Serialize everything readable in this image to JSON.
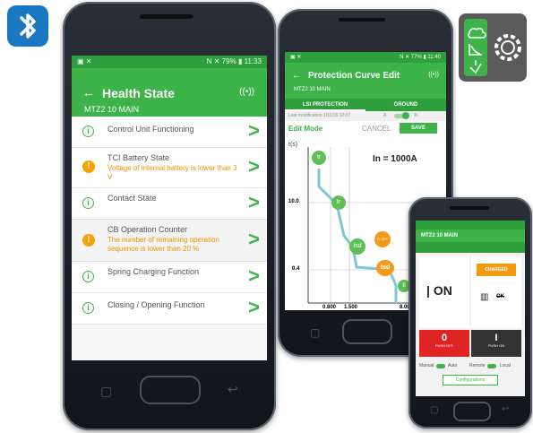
{
  "colors": {
    "green": "#3db34a",
    "orange": "#f5a300",
    "red": "#e02424",
    "blue": "#1a78c2"
  },
  "bluetooth_badge": {
    "icon": "bluetooth-icon"
  },
  "app_icon": {
    "icons": [
      "gear-icon",
      "cloud-icon",
      "curve-icon",
      "breaker-icon"
    ]
  },
  "phone1": {
    "status": {
      "left": "▣  ✕",
      "right": "N ✕ 79% ▮ 11:33"
    },
    "title": "Health State",
    "subtitle": "MTZ2 10 MAIN",
    "items": [
      {
        "label": "Control Unit Functioning",
        "icon": "info-icon",
        "warning": ""
      },
      {
        "label": "TCI Battery State",
        "icon": "warning-icon",
        "warning": "Voltage of internal battery is lower than 3 V"
      },
      {
        "label": "Contact State",
        "icon": "info-icon",
        "warning": ""
      },
      {
        "label": "CB Operation Counter",
        "icon": "warning-icon",
        "warning": "The number of remaining operation sequence is lower than 20 %"
      },
      {
        "label": "Spring Charging Function",
        "icon": "info-icon",
        "warning": ""
      },
      {
        "label": "Closing / Opening Function",
        "icon": "info-icon",
        "warning": ""
      }
    ]
  },
  "phone2": {
    "status": {
      "left": "▣  ✕",
      "right": "N ✕ 77% ▮ 11:40"
    },
    "title": "Protection Curve Edit",
    "subtitle": "MTZ2 10 MAIN",
    "tabs": [
      "LSI PROTECTION",
      "GROUND"
    ],
    "last_modification": "Last modification 1/11/16 12:07",
    "toggle_left": "A",
    "toggle_right": "%",
    "edit_mode": "Edit Mode",
    "cancel": "CANCEL",
    "save": "SAVE",
    "in_label": "In = 1000A",
    "y_axis": "t(s)",
    "y_ticks": [
      "10.0",
      "0.4"
    ],
    "x_ticks": [
      "0.800",
      "1.500",
      "8.000"
    ],
    "nodes": {
      "ir": "Ir",
      "tr": "tr",
      "isd": "Isd",
      "tsd": "tsd",
      "i2t": "I²t OFF",
      "ii": "Ii"
    }
  },
  "phone3": {
    "title": "MTZ2 10 MAIN",
    "state": "ON",
    "charged": "CHARGED",
    "ok": "OK",
    "push_off_value": "0",
    "push_off_label": "PUSH OFF",
    "push_on_value": "I",
    "push_on_label": "PUSH ON",
    "manual": "Manual",
    "auto": "Auto",
    "remote": "Remote",
    "local": "Local",
    "configurations": "Configurations"
  }
}
